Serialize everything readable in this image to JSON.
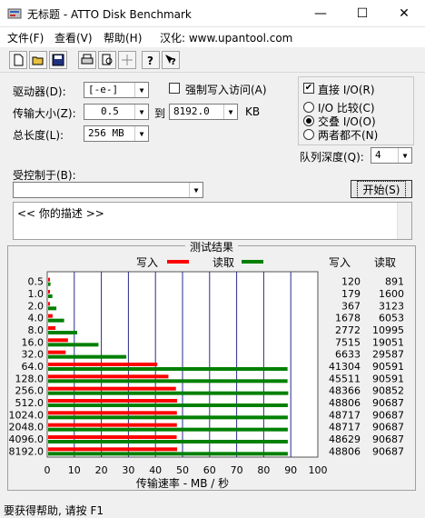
{
  "window": {
    "title": "无标题 - ATTO Disk Benchmark"
  },
  "titlebar_controls": {
    "minimize": "—",
    "maximize": "☐",
    "close": "✕"
  },
  "menu": [
    {
      "label": "文件(F)"
    },
    {
      "label": "查看(V)"
    },
    {
      "label": "帮助(H)"
    },
    {
      "label": "汉化: www.upantool.com"
    }
  ],
  "toolbar": {
    "buttons": [
      "new-file-icon",
      "open-folder-icon",
      "save-icon",
      "print-icon",
      "print-preview-icon",
      "move-icon",
      "help-icon",
      "context-help-icon"
    ]
  },
  "settings": {
    "drive_label": "驱动器(D):",
    "drive_value": "[-e-]",
    "force_write_label": "强制写入访问(A)",
    "transfer_size_label": "传输大小(Z):",
    "transfer_from": "0.5",
    "transfer_to_label": "到",
    "transfer_to": "8192.0",
    "transfer_unit": "KB",
    "total_length_label": "总长度(L):",
    "total_length_value": "256 MB",
    "direct_io_label": "直接 I/O(R)",
    "direct_io_checked": true,
    "io_compare_label": "I/O 比较(C)",
    "overlapped_io_label": "交叠 I/O(O)",
    "neither_label": "两者都不(N)",
    "selected_io_mode": "overlapped",
    "queue_depth_label": "队列深度(Q):",
    "queue_depth_value": "4",
    "controlled_by_label": "受控制于(B):",
    "controlled_by_value": "",
    "start_button": "开始(S)",
    "description_text": "<<  你的描述  >>"
  },
  "results": {
    "title": "测试结果",
    "write_legend": "写入",
    "read_legend": "读取",
    "col_write": "写入",
    "col_read": "读取",
    "write_color": "#ff0000",
    "read_color": "#008000"
  },
  "chart_data": {
    "type": "bar",
    "orientation": "horizontal",
    "categories": [
      "0.5",
      "1.0",
      "2.0",
      "4.0",
      "8.0",
      "16.0",
      "32.0",
      "64.0",
      "128.0",
      "256.0",
      "512.0",
      "1024.0",
      "2048.0",
      "4096.0",
      "8192.0"
    ],
    "series": [
      {
        "name": "写入",
        "values": [
          120,
          179,
          367,
          1678,
          2772,
          7515,
          6633,
          41304,
          45511,
          48366,
          48806,
          48717,
          48717,
          48629,
          48806
        ]
      },
      {
        "name": "读取",
        "values": [
          891,
          1600,
          3123,
          6053,
          10995,
          19051,
          29587,
          90591,
          90591,
          90852,
          90687,
          90687,
          90687,
          90687,
          90687
        ]
      }
    ],
    "xlabel": "传输速率 - MB / 秒",
    "xlim": [
      0,
      100
    ],
    "xticks": [
      "0",
      "10",
      "20",
      "30",
      "40",
      "50",
      "60",
      "70",
      "80",
      "90",
      "100"
    ]
  },
  "status": {
    "text": "要获得帮助, 请按 F1"
  }
}
